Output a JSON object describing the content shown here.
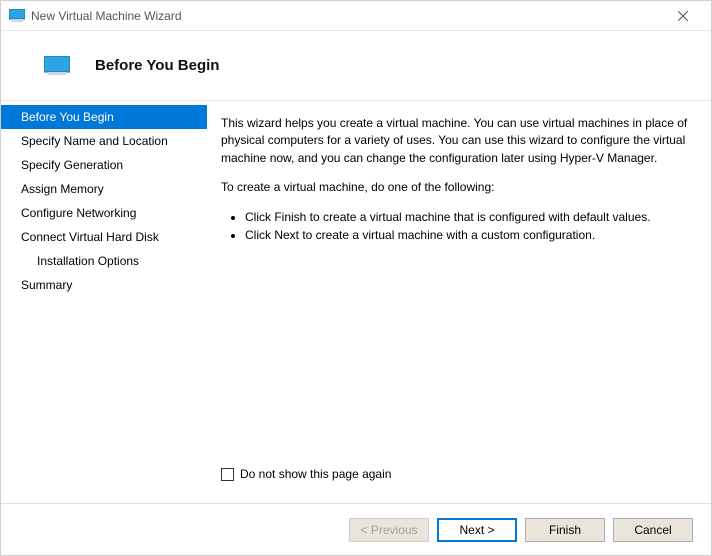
{
  "window": {
    "title": "New Virtual Machine Wizard"
  },
  "header": {
    "title": "Before You Begin"
  },
  "sidebar": {
    "items": [
      {
        "label": "Before You Begin",
        "active": true
      },
      {
        "label": "Specify Name and Location"
      },
      {
        "label": "Specify Generation"
      },
      {
        "label": "Assign Memory"
      },
      {
        "label": "Configure Networking"
      },
      {
        "label": "Connect Virtual Hard Disk"
      },
      {
        "label": "Installation Options",
        "sub": true
      },
      {
        "label": "Summary"
      }
    ]
  },
  "content": {
    "intro": "This wizard helps you create a virtual machine. You can use virtual machines in place of physical computers for a variety of uses. You can use this wizard to configure the virtual machine now, and you can change the configuration later using Hyper-V Manager.",
    "prompt": "To create a virtual machine, do one of the following:",
    "bullets": [
      "Click Finish to create a virtual machine that is configured with default values.",
      "Click Next to create a virtual machine with a custom configuration."
    ],
    "checkbox_label": "Do not show this page again"
  },
  "footer": {
    "previous": "< Previous",
    "next": "Next >",
    "finish": "Finish",
    "cancel": "Cancel"
  }
}
